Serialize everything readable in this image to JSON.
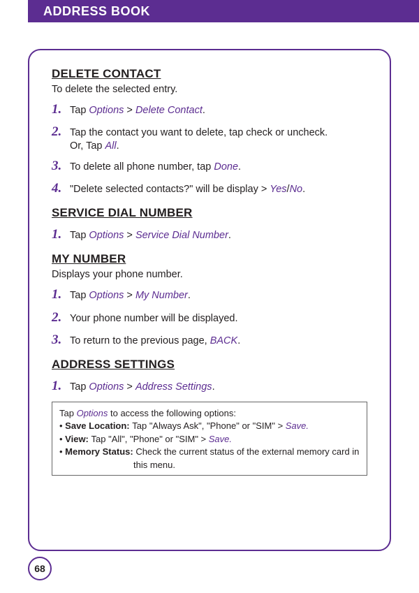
{
  "header": {
    "title": "ADDRESS BOOK"
  },
  "page": "68",
  "delete_contact": {
    "title": "DELETE CONTACT",
    "intro": "To delete the selected entry.",
    "s1_tap": "Tap ",
    "s1_opt": "Options",
    "s1_gt": " > ",
    "s1_dc": "Delete Contact",
    "s1_dot": ".",
    "s2": "Tap the contact you want to delete, tap check or uncheck.",
    "s2_or_pre": "Or, Tap ",
    "s2_or_all": "All",
    "s2_or_dot": ".",
    "s3_pre": "To delete all phone number, tap ",
    "s3_done": "Done",
    "s3_dot": ".",
    "s4_pre": "\"Delete selected contacts?\" will be display > ",
    "s4_yes": "Yes",
    "s4_slash": "/",
    "s4_no": "No",
    "s4_dot": "."
  },
  "service_dial": {
    "title": "SERVICE DIAL NUMBER",
    "s1_tap": "Tap ",
    "s1_opt": "Options",
    "s1_gt": " > ",
    "s1_sdn": "Service Dial Number",
    "s1_dot": "."
  },
  "my_number": {
    "title": "MY NUMBER",
    "intro": "Displays your phone number.",
    "s1_tap": "Tap ",
    "s1_opt": "Options",
    "s1_gt": " > ",
    "s1_mn": "My Number",
    "s1_dot": ".",
    "s2": "Your phone number will be displayed.",
    "s3_pre": "To return to the previous page, ",
    "s3_back": "BACK",
    "s3_dot": "."
  },
  "address_settings": {
    "title": "ADDRESS SETTINGS",
    "s1_tap": "Tap ",
    "s1_opt": "Options",
    "s1_gt": " > ",
    "s1_as": "Address Settings",
    "s1_dot": ".",
    "box": {
      "l1_pre": "Tap ",
      "l1_opt": "Options",
      "l1_post": " to access the following options:",
      "l2_pre": "• ",
      "l2_bold": "Save Location: ",
      "l2_mid": "Tap \"Always Ask\", \"Phone\" or \"SIM\" > ",
      "l2_save": "Save.",
      "l3_pre": "• ",
      "l3_bold": "View: ",
      "l3_mid": "Tap \"All\", \"Phone\" or \"SIM\" > ",
      "l3_save": "Save.",
      "l4_pre": "• ",
      "l4_bold": "Memory Status: ",
      "l4_mid": "Check the current status of the external memory card in",
      "l4_cont": "this menu."
    }
  }
}
